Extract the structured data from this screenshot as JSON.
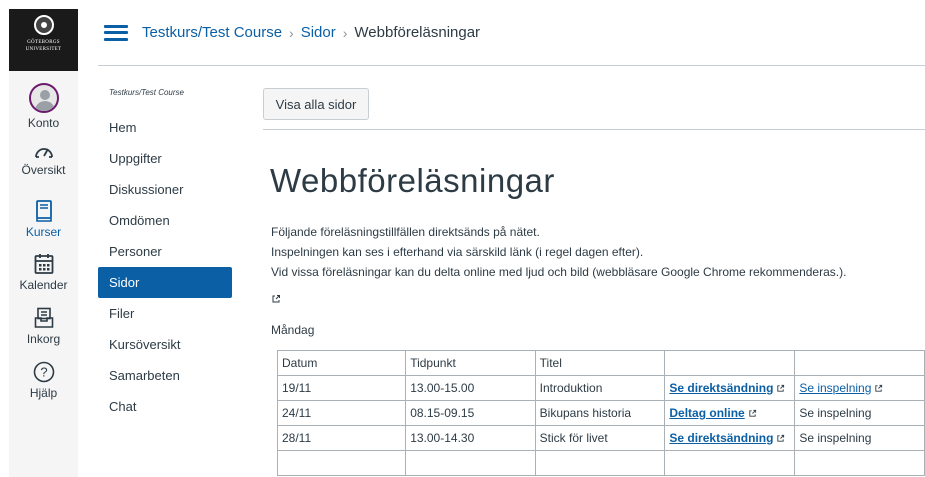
{
  "global_nav": {
    "logo_text_line1": "GÖTEBORGS",
    "logo_text_line2": "UNIVERSITET",
    "items": [
      {
        "label": "Konto",
        "icon": "avatar-icon"
      },
      {
        "label": "Översikt",
        "icon": "dashboard-icon"
      },
      {
        "label": "Kurser",
        "icon": "courses-icon",
        "active": true
      },
      {
        "label": "Kalender",
        "icon": "calendar-icon"
      },
      {
        "label": "Inkorg",
        "icon": "inbox-icon"
      },
      {
        "label": "Hjälp",
        "icon": "help-icon"
      }
    ]
  },
  "header": {
    "breadcrumb": {
      "course": "Testkurs/Test Course",
      "section": "Sidor",
      "current": "Webbföreläsningar",
      "separator": "›"
    }
  },
  "course_nav": {
    "course_title": "Testkurs/Test Course",
    "items": [
      {
        "label": "Hem"
      },
      {
        "label": "Uppgifter"
      },
      {
        "label": "Diskussioner"
      },
      {
        "label": "Omdömen"
      },
      {
        "label": "Personer"
      },
      {
        "label": "Sidor",
        "active": true
      },
      {
        "label": "Filer"
      },
      {
        "label": "Kursöversikt"
      },
      {
        "label": "Samarbeten"
      },
      {
        "label": "Chat"
      }
    ]
  },
  "toolbar": {
    "view_all_label": "Visa alla sidor"
  },
  "page": {
    "title": "Webbföreläsningar",
    "intro_lines": [
      "Följande föreläsningstillfällen direktsänds på nätet.",
      "Inspelningen kan ses i efterhand via särskild länk (i regel dagen efter).",
      "Vid vissa föreläsningar kan du delta online med ljud och bild (webbläsare Google Chrome rekommenderas.)."
    ],
    "day_label": "Måndag",
    "table": {
      "headers": [
        "Datum",
        "Tidpunkt",
        "Titel",
        "",
        ""
      ],
      "rows": [
        {
          "date": "19/11",
          "time": "13.00-15.00",
          "title": "Introduktion",
          "link1": "Se direktsändning",
          "link2": "Se inspelning",
          "link2_is_link": true
        },
        {
          "date": "24/11",
          "time": "08.15-09.15",
          "title": "Bikupans historia",
          "link1": "Deltag online",
          "link2": "Se inspelning",
          "link2_is_link": false
        },
        {
          "date": "28/11",
          "time": "13.00-14.30",
          "title": "Stick för livet",
          "link1": "Se direktsändning",
          "link2": "Se inspelning",
          "link2_is_link": false
        }
      ]
    }
  },
  "colors": {
    "brand_blue": "#0b5fa5",
    "text": "#2d3b45",
    "logo_bg": "#1a1a1a",
    "border": "#c7cdd1"
  }
}
